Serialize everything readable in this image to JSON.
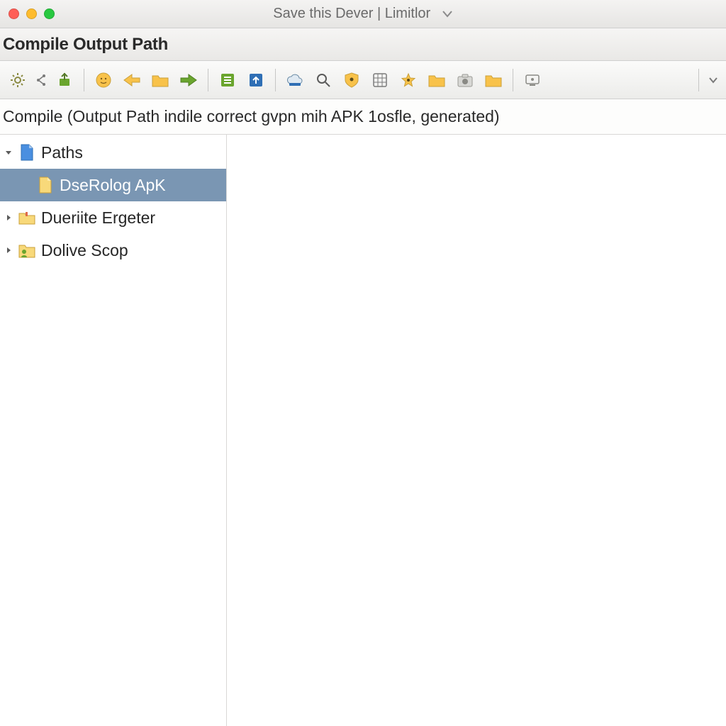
{
  "titlebar": {
    "title": "Save this Dever | Limitlor"
  },
  "subtitle": "Compile Output Path",
  "description": "Compile (Output Path indile correct gvpn mih APK 1osfle, generated)",
  "toolbar": {
    "icons": [
      "settings-gear-icon",
      "share-icon",
      "import-icon",
      "sep",
      "sun-icon",
      "back-icon",
      "folder-icon",
      "forward-icon",
      "sep",
      "list-icon",
      "upload-blue-icon",
      "sep",
      "cloud-icon",
      "search-icon",
      "shield-icon",
      "grid-icon",
      "star-icon",
      "folder2-icon",
      "camera-icon",
      "folder3-icon",
      "sep",
      "device-icon"
    ]
  },
  "tree": {
    "root": {
      "label": "Paths",
      "expanded": true
    },
    "children": [
      {
        "label": "DseRolog ApK",
        "icon": "file-yellow-icon",
        "selected": true
      },
      {
        "label": "Dueriite Ergeter",
        "icon": "folder-yellow-icon",
        "expandable": true
      },
      {
        "label": "Dolive Scop",
        "icon": "folder-person-icon",
        "expandable": true
      }
    ]
  },
  "colors": {
    "selection": "#7a96b3",
    "yellow": "#f8c24a",
    "green": "#6aa52e",
    "blue": "#2f6fb5",
    "orange": "#e9a53a"
  }
}
